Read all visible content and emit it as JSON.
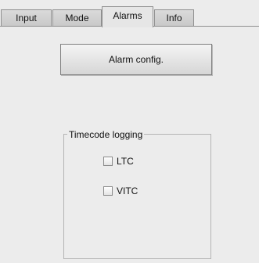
{
  "tabs": [
    {
      "label": "Input",
      "active": false
    },
    {
      "label": "Mode",
      "active": false
    },
    {
      "label": "Alarms",
      "active": true
    },
    {
      "label": "Info",
      "active": false
    }
  ],
  "alarm_config_button": "Alarm config.",
  "timecode_logging": {
    "title": "Timecode logging",
    "options": [
      {
        "label": "LTC",
        "checked": false
      },
      {
        "label": "VITC",
        "checked": false
      }
    ]
  }
}
